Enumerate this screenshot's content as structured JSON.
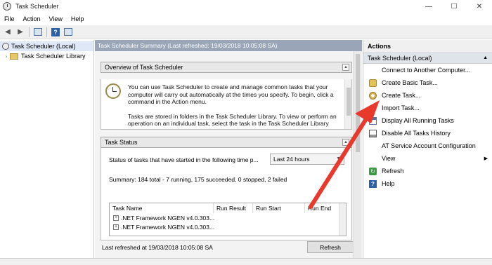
{
  "window": {
    "title": "Task Scheduler",
    "controls": [
      "—",
      "☐",
      "✕"
    ]
  },
  "menu": [
    "File",
    "Action",
    "View",
    "Help"
  ],
  "tree": {
    "root": "Task Scheduler (Local)",
    "library": "Task Scheduler Library"
  },
  "center": {
    "header": "Task Scheduler Summary (Last refreshed: 19/03/2018 10:05:08 SA)",
    "overview": {
      "title": "Overview of Task Scheduler",
      "para1": "You can use Task Scheduler to create and manage common tasks that your computer will carry out automatically at the times you specify. To begin, click a command in the Action menu.",
      "para2": "Tasks are stored in folders in the Task Scheduler Library. To view or perform an operation on an individual task, select the task in the Task Scheduler Library and click on a command in the Action menu."
    },
    "status": {
      "title": "Task Status",
      "label": "Status of tasks that have started in the following time p...",
      "period": "Last 24 hours",
      "summary": "Summary: 184 total - 7 running, 175 succeeded, 0 stopped, 2 failed",
      "columns": [
        "Task Name",
        "Run Result",
        "Run Start",
        "Run End"
      ],
      "rows": [
        ".NET Framework NGEN v4.0.303...",
        ".NET Framework NGEN v4.0.303..."
      ]
    },
    "footer": "Last refreshed at 19/03/2018 10:05:08 SA",
    "refresh_label": "Refresh"
  },
  "actions": {
    "title": "Actions",
    "group": "Task Scheduler (Local)",
    "items": [
      {
        "label": "Connect to Another Computer...",
        "icon": "none"
      },
      {
        "label": "Create Basic Task...",
        "icon": "basic-task-icon"
      },
      {
        "label": "Create Task...",
        "icon": "create-task-icon"
      },
      {
        "label": "Import Task...",
        "icon": "none"
      },
      {
        "label": "Display All Running Tasks",
        "icon": "running-tasks-icon"
      },
      {
        "label": "Disable All Tasks History",
        "icon": "history-icon"
      },
      {
        "label": "AT Service Account Configuration",
        "icon": "none"
      },
      {
        "label": "View",
        "icon": "none"
      },
      {
        "label": "Refresh",
        "icon": "refresh-icon"
      },
      {
        "label": "Help",
        "icon": "help-icon"
      }
    ]
  },
  "colors": {
    "annotation_arrow": "#e8392d",
    "header_bar": "#9aa6b7"
  }
}
